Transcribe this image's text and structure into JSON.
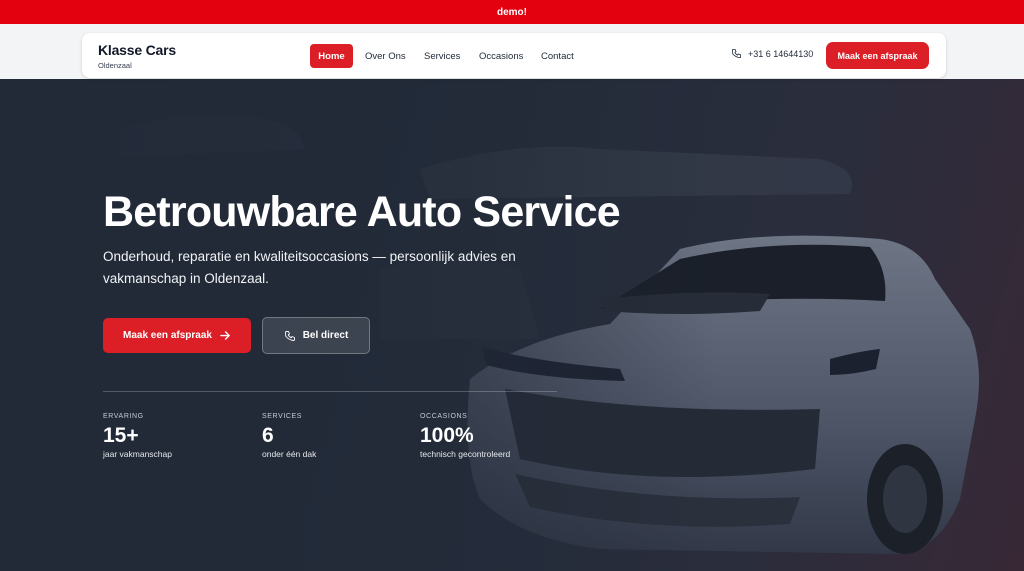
{
  "demo_banner": "demo!",
  "brand": {
    "name": "Klasse Cars",
    "location": "Oldenzaal"
  },
  "nav": {
    "home": "Home",
    "over_ons": "Over Ons",
    "services": "Services",
    "occasions": "Occasions",
    "contact": "Contact"
  },
  "header": {
    "phone": "+31 6 14644130",
    "cta": "Maak een afspraak"
  },
  "hero": {
    "title": "Betrouwbare Auto Service",
    "subtitle": "Onderhoud, reparatie en kwaliteitsoccasions — persoonlijk advies en vakmanschap in Oldenzaal.",
    "primary_button": "Maak een afspraak",
    "secondary_button": "Bel direct"
  },
  "stats": [
    {
      "label": "ERVARING",
      "value": "15+",
      "desc": "jaar vakmanschap"
    },
    {
      "label": "SERVICES",
      "value": "6",
      "desc": "onder één dak"
    },
    {
      "label": "OCCASIONS",
      "value": "100%",
      "desc": "technisch gecontroleerd"
    }
  ],
  "colors": {
    "accent": "#dc1f26",
    "demo_bar": "#e3000f",
    "hero_dark": "#212a38"
  },
  "icons": {
    "phone": "phone-icon",
    "arrow": "arrow-right-icon",
    "car": "car-background-image"
  }
}
